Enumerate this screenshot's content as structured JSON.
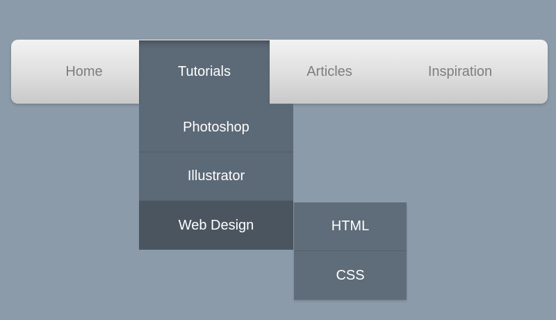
{
  "nav": {
    "items": [
      {
        "label": "Home"
      },
      {
        "label": "Tutorials"
      },
      {
        "label": "Articles"
      },
      {
        "label": "Inspiration"
      }
    ],
    "active_index": 1
  },
  "tutorials_menu": {
    "items": [
      {
        "label": "Photoshop"
      },
      {
        "label": "Illustrator"
      },
      {
        "label": "Web Design"
      }
    ],
    "hovered_index": 2
  },
  "web_design_submenu": {
    "items": [
      {
        "label": "HTML"
      },
      {
        "label": "CSS"
      }
    ]
  },
  "colors": {
    "background": "#8c9ba9",
    "menu_item": "#5c6976",
    "menu_item_hover": "#4b5560",
    "nav_text": "#7d7d7d"
  }
}
